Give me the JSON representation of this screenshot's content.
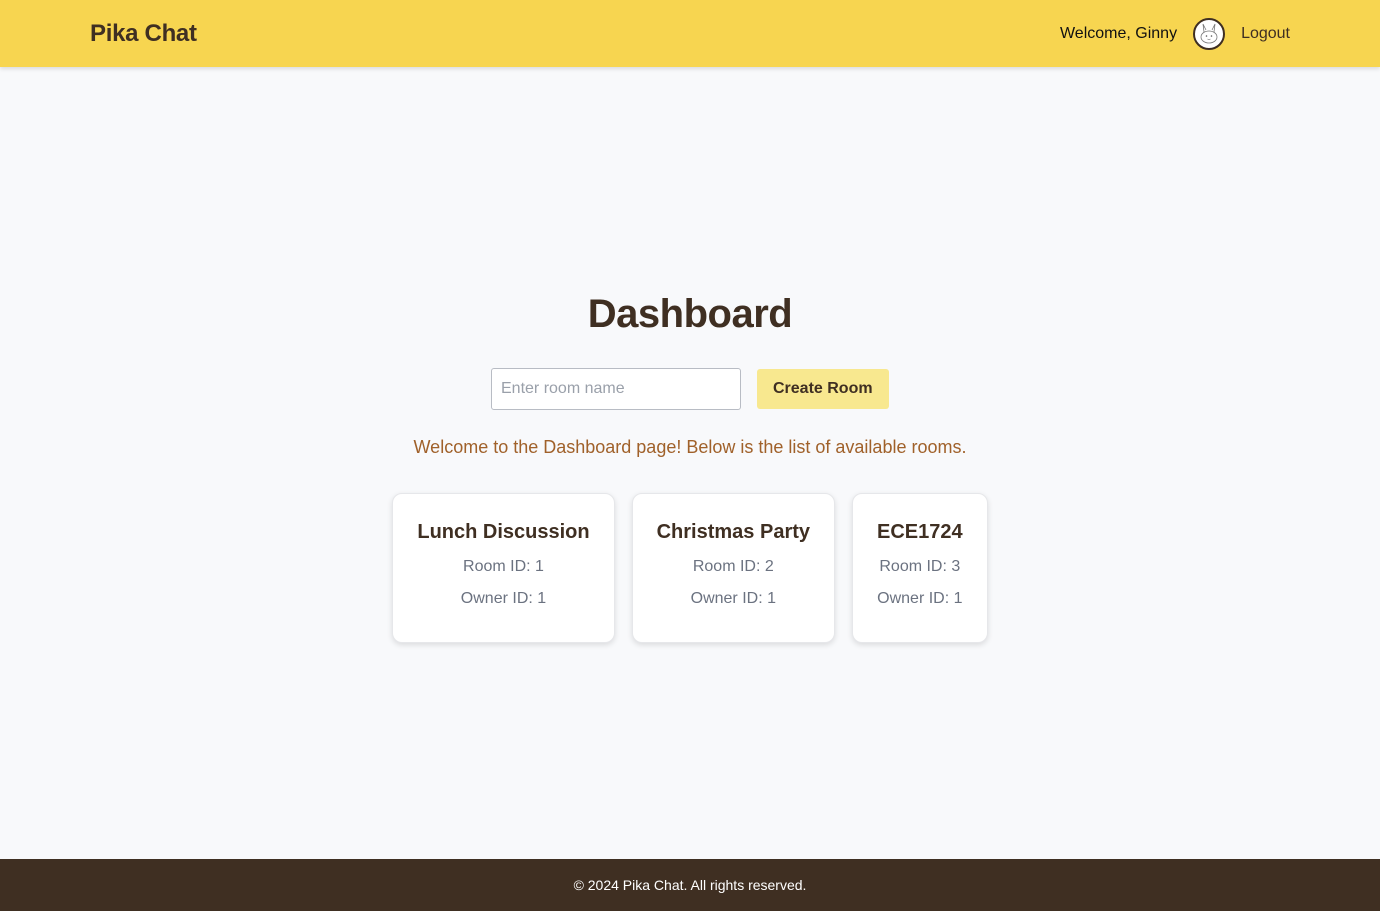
{
  "header": {
    "brand": "Pika Chat",
    "welcome": "Welcome, Ginny",
    "avatar_icon": "pikachu-avatar-icon",
    "logout": "Logout"
  },
  "main": {
    "title": "Dashboard",
    "room_input": {
      "placeholder": "Enter room name",
      "value": ""
    },
    "create_button": "Create Room",
    "intro": "Welcome to the Dashboard page! Below is the list of available rooms.",
    "rooms": [
      {
        "name": "Lunch Discussion",
        "room_id": "Room ID: 1",
        "owner_id": "Owner ID: 1"
      },
      {
        "name": "Christmas Party",
        "room_id": "Room ID: 2",
        "owner_id": "Owner ID: 1"
      },
      {
        "name": "ECE1724",
        "room_id": "Room ID: 3",
        "owner_id": "Owner ID: 1"
      }
    ]
  },
  "footer": {
    "text": "© 2024 Pika Chat. All rights reserved."
  },
  "colors": {
    "header_bg": "#f7d550",
    "brand_text": "#3f2f22",
    "button_bg": "#f8e88f",
    "intro_text": "#a0612a",
    "footer_bg": "#3f2f22",
    "page_bg": "#f8f9fb"
  }
}
